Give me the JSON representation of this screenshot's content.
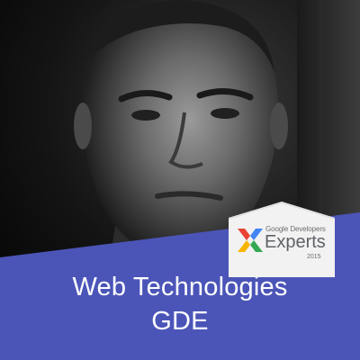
{
  "banner": {
    "line1": "Web Technologies",
    "line2": "GDE",
    "color": "#4b55b8"
  },
  "badge": {
    "small_text": "Google Developers",
    "big_text": "Experts",
    "year": "2015",
    "logo_icon": "gde-chevron-logo-icon",
    "colors": {
      "red": "#e94235",
      "yellow": "#f7b500",
      "green": "#34a853",
      "blue": "#4285f4"
    }
  }
}
